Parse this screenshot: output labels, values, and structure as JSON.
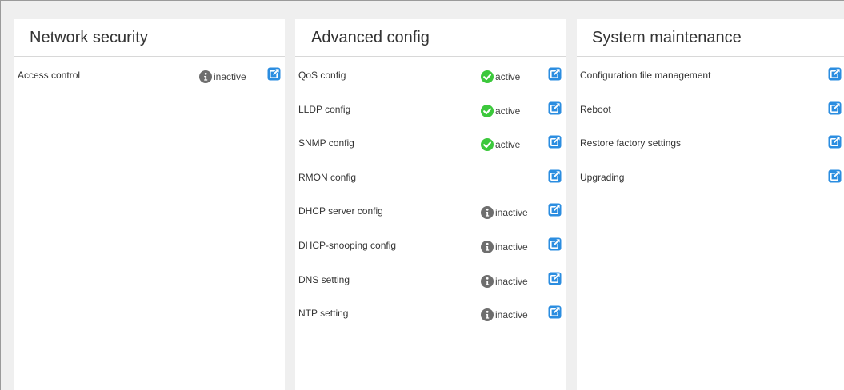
{
  "colors": {
    "accent": "#2b8de0",
    "active": "#3cc83c",
    "inactive": "#6e6e6e",
    "panel_bg": "#ffffff",
    "page_bg": "#efefef"
  },
  "panels": [
    {
      "title": "Network security",
      "items": [
        {
          "label": "Access control",
          "status": "inactive",
          "status_icon": "info-icon"
        }
      ]
    },
    {
      "title": "Advanced config",
      "items": [
        {
          "label": "QoS config",
          "status": "active",
          "status_icon": "check-icon"
        },
        {
          "label": "LLDP config",
          "status": "active",
          "status_icon": "check-icon"
        },
        {
          "label": "SNMP config",
          "status": "active",
          "status_icon": "check-icon"
        },
        {
          "label": "RMON config",
          "status": "",
          "status_icon": ""
        },
        {
          "label": "DHCP server config",
          "status": "inactive",
          "status_icon": "info-icon"
        },
        {
          "label": "DHCP-snooping config",
          "status": "inactive",
          "status_icon": "info-icon"
        },
        {
          "label": "DNS setting",
          "status": "inactive",
          "status_icon": "info-icon"
        },
        {
          "label": "NTP setting",
          "status": "inactive",
          "status_icon": "info-icon"
        }
      ]
    },
    {
      "title": "System maintenance",
      "items": [
        {
          "label": "Configuration file management",
          "status": "",
          "status_icon": ""
        },
        {
          "label": "Reboot",
          "status": "",
          "status_icon": ""
        },
        {
          "label": "Restore factory settings",
          "status": "",
          "status_icon": ""
        },
        {
          "label": "Upgrading",
          "status": "",
          "status_icon": ""
        }
      ]
    }
  ],
  "icons": {
    "link": "external-link-icon"
  }
}
